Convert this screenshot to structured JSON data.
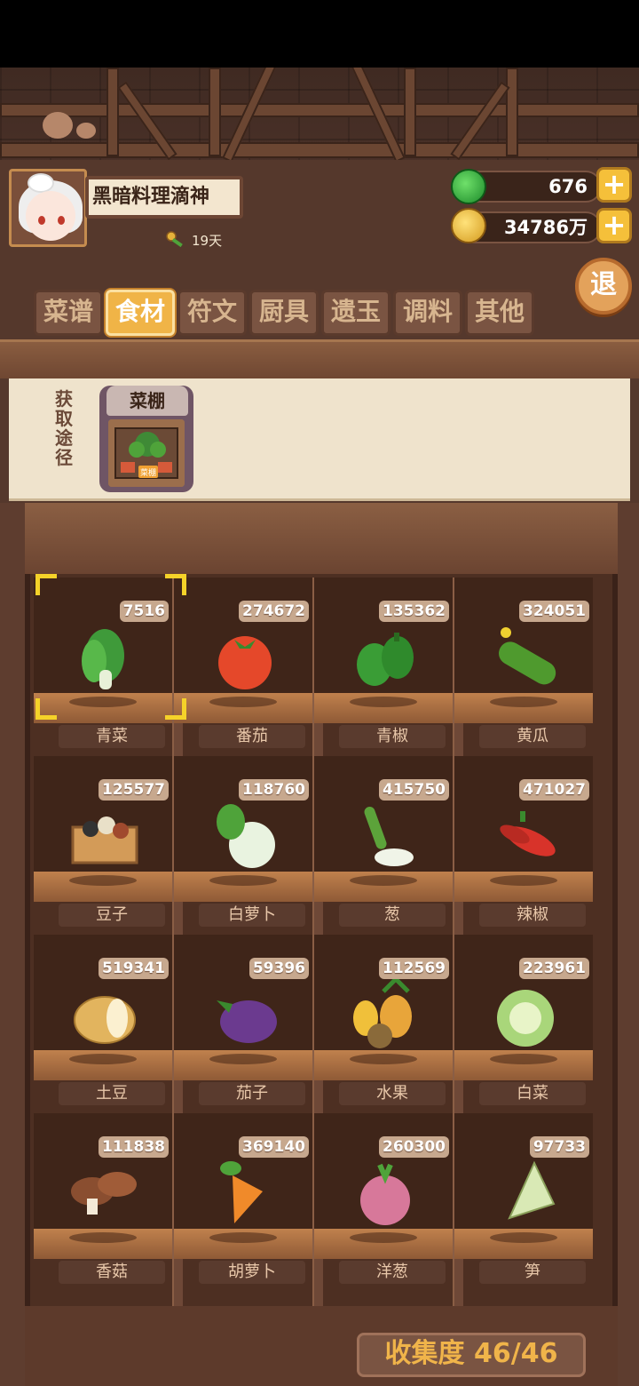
{
  "player": {
    "name": "黑暗料理滴神",
    "days": "19天"
  },
  "currency": {
    "jade": "676",
    "coins": "34786万"
  },
  "exit_label": "退",
  "tabs": [
    {
      "label": "菜谱"
    },
    {
      "label": "食材"
    },
    {
      "label": "符文"
    },
    {
      "label": "厨具"
    },
    {
      "label": "遗玉"
    },
    {
      "label": "调料"
    },
    {
      "label": "其他"
    }
  ],
  "active_tab": "食材",
  "source": {
    "label": "获取途径",
    "card_title": "菜棚",
    "card_sign": "菜棚"
  },
  "ingredients": [
    {
      "name": "青菜",
      "count": "7516",
      "icon": "bok-choy-icon",
      "color": "#3f9a3a"
    },
    {
      "name": "番茄",
      "count": "274672",
      "icon": "tomato-icon",
      "color": "#e5482a"
    },
    {
      "name": "青椒",
      "count": "135362",
      "icon": "green-pepper-icon",
      "color": "#3a9d36"
    },
    {
      "name": "黄瓜",
      "count": "324051",
      "icon": "cucumber-icon",
      "color": "#4f9a2e"
    },
    {
      "name": "豆子",
      "count": "125577",
      "icon": "beans-box-icon",
      "color": "#d39b58"
    },
    {
      "name": "白萝卜",
      "count": "118760",
      "icon": "white-radish-icon",
      "color": "#e9f3e0"
    },
    {
      "name": "葱",
      "count": "415750",
      "icon": "scallion-icon",
      "color": "#5ca33a"
    },
    {
      "name": "辣椒",
      "count": "471027",
      "icon": "chili-icon",
      "color": "#d8332a"
    },
    {
      "name": "土豆",
      "count": "519341",
      "icon": "potato-icon",
      "color": "#e2b45e"
    },
    {
      "name": "茄子",
      "count": "59396",
      "icon": "eggplant-icon",
      "color": "#6b3a8f"
    },
    {
      "name": "水果",
      "count": "112569",
      "icon": "fruit-icon",
      "color": "#f0c03a"
    },
    {
      "name": "白菜",
      "count": "223961",
      "icon": "cabbage-icon",
      "color": "#a9d67a"
    },
    {
      "name": "香菇",
      "count": "111838",
      "icon": "mushroom-icon",
      "color": "#8a4e30"
    },
    {
      "name": "胡萝卜",
      "count": "369140",
      "icon": "carrot-icon",
      "color": "#f08a2a"
    },
    {
      "name": "洋葱",
      "count": "260300",
      "icon": "onion-icon",
      "color": "#d7789a"
    },
    {
      "name": "笋",
      "count": "97733",
      "icon": "bamboo-shoot-icon",
      "color": "#d9e9b5"
    }
  ],
  "selected_ingredient": "青菜",
  "collection": "收集度 46/46"
}
